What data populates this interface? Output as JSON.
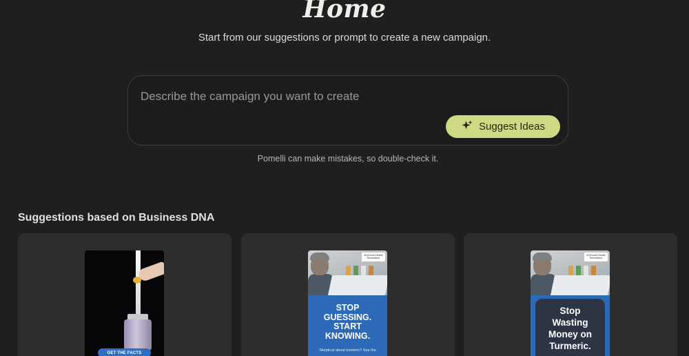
{
  "header": {
    "title": "Home",
    "subtitle": "Start from our suggestions or prompt to create a new campaign."
  },
  "prompt": {
    "placeholder": "Describe the campaign you want to create",
    "value": "",
    "suggest_button_label": "Suggest Ideas",
    "suggest_button_icon": "sparkle-icon"
  },
  "disclaimer": "Pomelli can make mistakes, so double-check it.",
  "suggestions": {
    "heading": "Suggestions based on Business DNA",
    "cards": [
      {
        "thumbnail_cta": "GET THE FACTS"
      },
      {
        "thumbnail_tag": "#DrGundri Health Revelations",
        "thumbnail_headline": "STOP\nGUESSING.\nSTART\nKNOWING.",
        "thumbnail_subtext": "Skeptical about turmeric? See the"
      },
      {
        "thumbnail_tag": "#DrGundri Health Revelations",
        "thumbnail_headline": "Stop\nWasting\nMoney on\nTurmeric."
      }
    ]
  },
  "colors": {
    "background": "#1f1f1f",
    "card": "#2d2d2d",
    "accent_button": "#cfd882",
    "thumbnail_blue": "#2c69b6"
  }
}
